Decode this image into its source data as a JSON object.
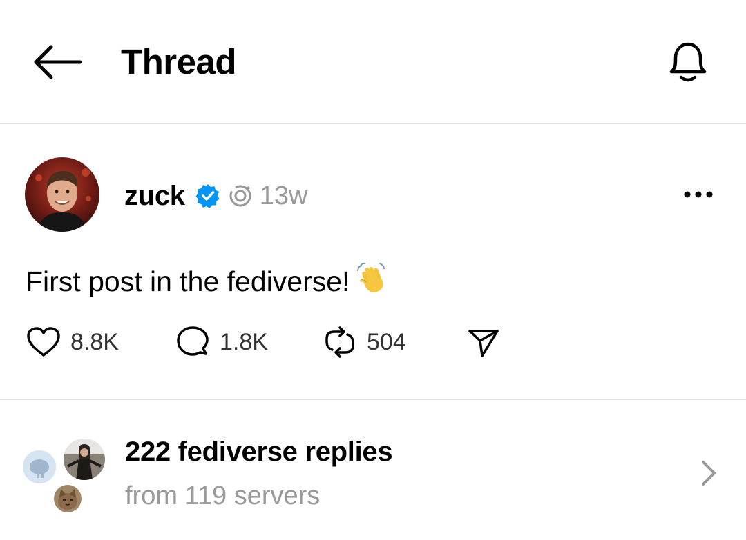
{
  "header": {
    "title": "Thread",
    "back_icon": "arrow-left-icon",
    "notification_icon": "bell-icon"
  },
  "post": {
    "username": "zuck",
    "verified_icon": "verified-badge-icon",
    "fediverse_icon": "fediverse-icon",
    "time": "13w",
    "more_icon": "more-horizontal-icon",
    "text": "First post in the fediverse!",
    "emoji": "waving-hand-emoji",
    "actions": {
      "likes": "8.8K",
      "replies": "1.8K",
      "reposts": "504",
      "share_icon": "send-icon"
    }
  },
  "fediverse_replies": {
    "title": "222 fediverse replies",
    "subtitle": "from 119 servers",
    "chevron_icon": "chevron-right-icon"
  },
  "colors": {
    "text": "#000000",
    "secondary_text": "#999999",
    "verified": "#0095f6",
    "divider": "#e1e1e1"
  }
}
